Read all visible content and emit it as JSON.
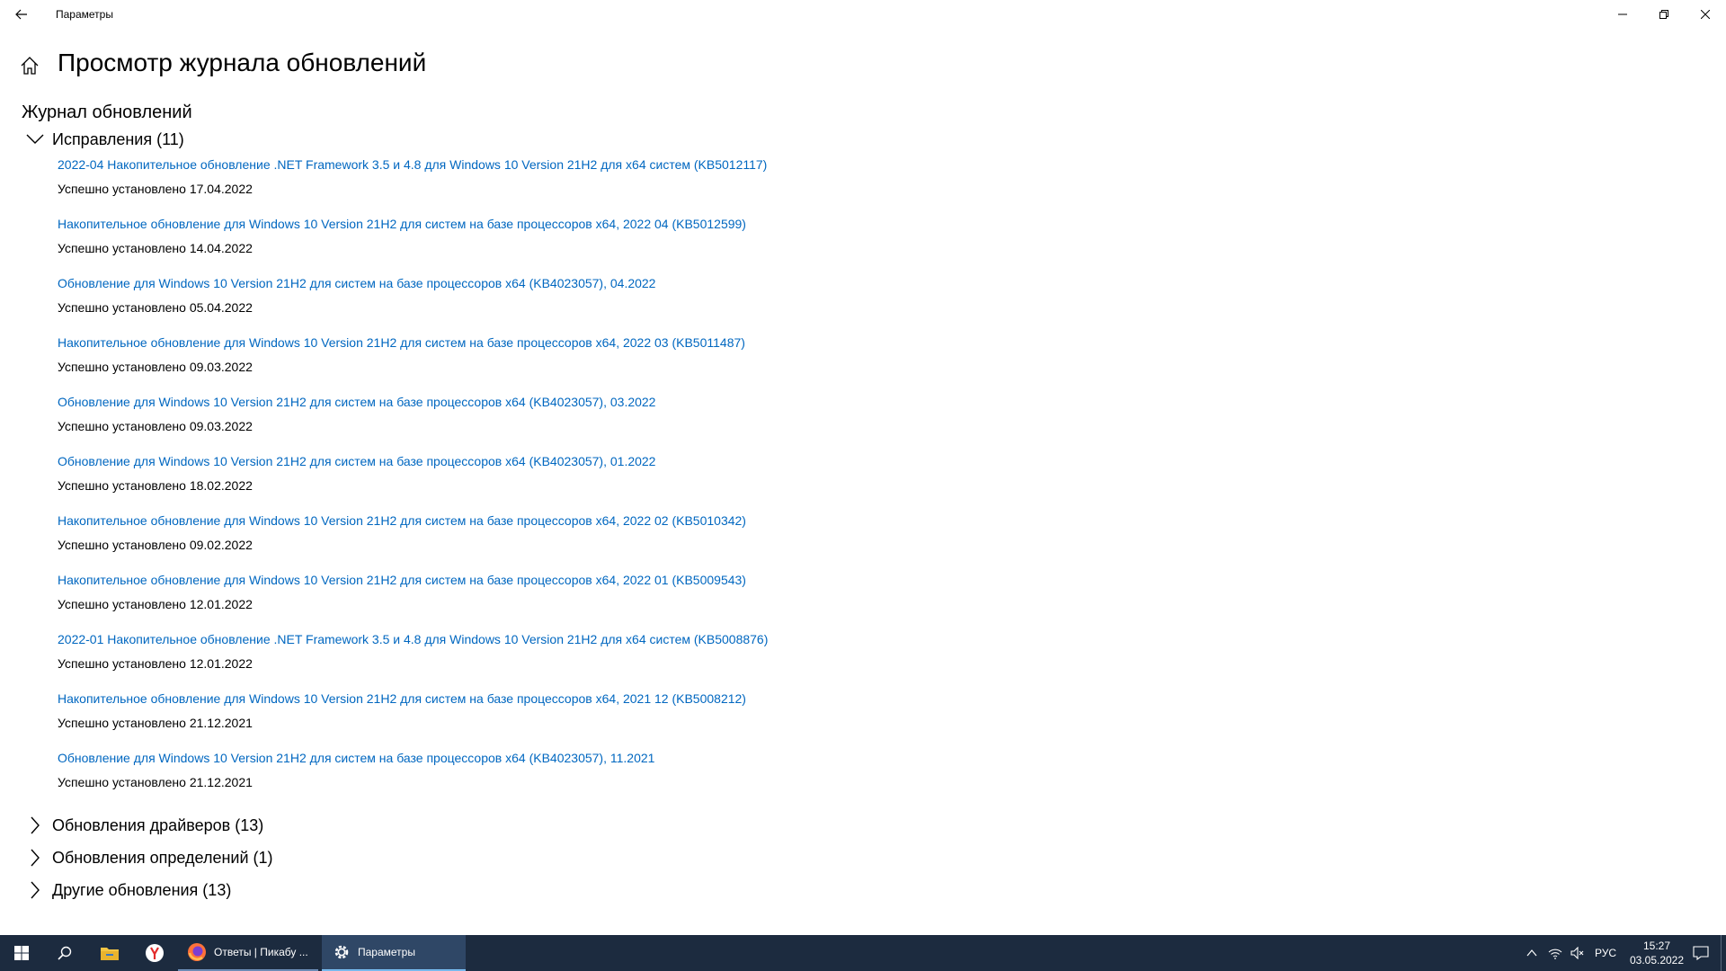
{
  "window": {
    "title": "Параметры"
  },
  "page": {
    "title": "Просмотр журнала обновлений",
    "section_title": "Журнал обновлений"
  },
  "groups": {
    "fixes": {
      "label": "Исправления (11)",
      "expanded": true
    },
    "drivers": {
      "label": "Обновления драйверов (13)",
      "expanded": false
    },
    "definitions": {
      "label": "Обновления определений (1)",
      "expanded": false
    },
    "other": {
      "label": "Другие обновления (13)",
      "expanded": false
    }
  },
  "updates": [
    {
      "name": "2022-04 Накопительное обновление .NET Framework 3.5 и 4.8 для Windows 10 Version 21H2 для x64 систем (KB5012117)",
      "status": "Успешно установлено 17.04.2022"
    },
    {
      "name": "Накопительное обновление для Windows 10 Version 21H2 для систем на базе процессоров x64, 2022 04 (KB5012599)",
      "status": "Успешно установлено 14.04.2022"
    },
    {
      "name": "Обновление для Windows 10 Version 21H2 для систем на базе процессоров x64 (KB4023057), 04.2022",
      "status": "Успешно установлено 05.04.2022"
    },
    {
      "name": "Накопительное обновление для Windows 10 Version 21H2 для систем на базе процессоров x64, 2022 03 (KB5011487)",
      "status": "Успешно установлено 09.03.2022"
    },
    {
      "name": "Обновление для Windows 10 Version 21H2 для систем на базе процессоров x64 (KB4023057), 03.2022",
      "status": "Успешно установлено 09.03.2022"
    },
    {
      "name": "Обновление для Windows 10 Version 21H2 для систем на базе процессоров x64 (KB4023057), 01.2022",
      "status": "Успешно установлено 18.02.2022"
    },
    {
      "name": "Накопительное обновление для Windows 10 Version 21H2 для систем на базе процессоров x64, 2022 02 (KB5010342)",
      "status": "Успешно установлено 09.02.2022"
    },
    {
      "name": "Накопительное обновление для Windows 10 Version 21H2 для систем на базе процессоров x64, 2022 01 (KB5009543)",
      "status": "Успешно установлено 12.01.2022"
    },
    {
      "name": "2022-01 Накопительное обновление .NET Framework 3.5 и 4.8 для Windows 10 Version 21H2 для x64 систем (KB5008876)",
      "status": "Успешно установлено 12.01.2022"
    },
    {
      "name": "Накопительное обновление для Windows 10 Version 21H2 для систем на базе процессоров x64, 2021 12 (KB5008212)",
      "status": "Успешно установлено 21.12.2021"
    },
    {
      "name": "Обновление для Windows 10 Version 21H2 для систем на базе процессоров x64 (KB4023057), 11.2021",
      "status": "Успешно установлено 21.12.2021"
    }
  ],
  "taskbar": {
    "firefox_label": "Ответы | Пикабу ...",
    "settings_label": "Параметры",
    "language": "РУС",
    "time": "15:27",
    "date": "03.05.2022"
  },
  "colors": {
    "link": "#0067c0",
    "taskbar_bg": "#1c2b3f",
    "active_task": "#2f4766"
  }
}
